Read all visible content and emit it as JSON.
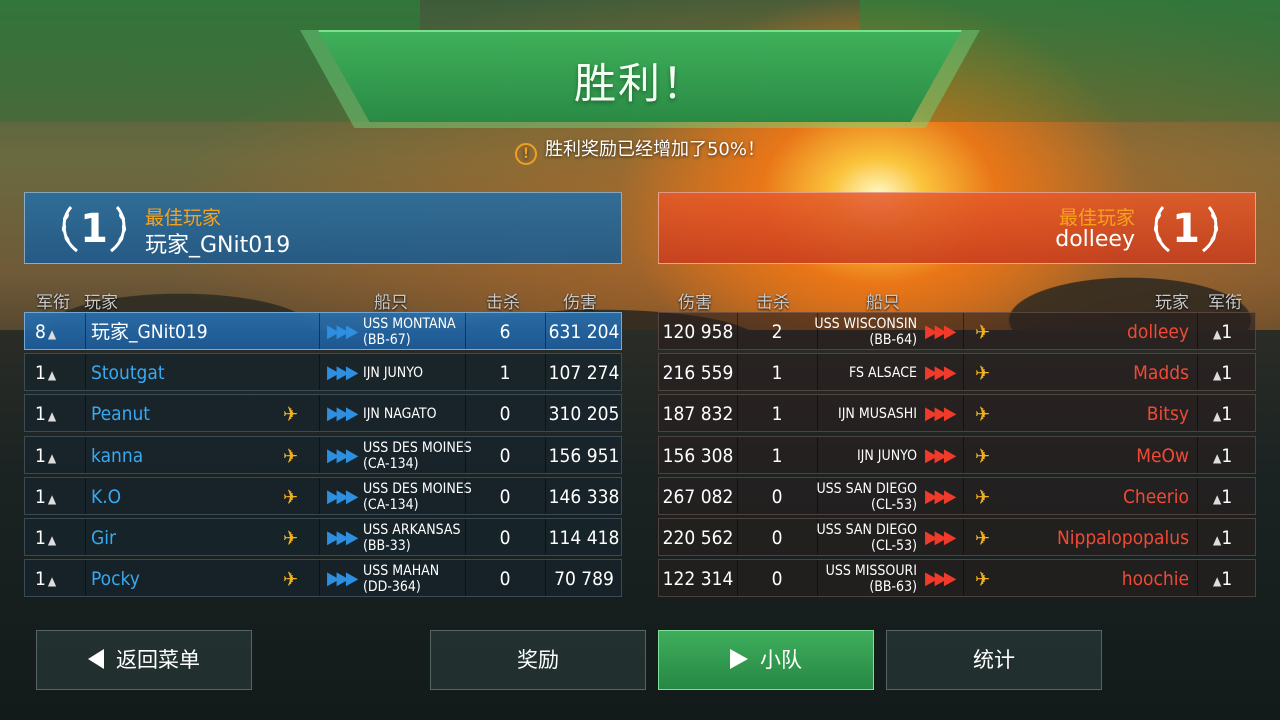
{
  "title": "胜利！",
  "bonus_text": "胜利奖励已经增加了50%！",
  "blue_mvp": {
    "label": "最佳玩家",
    "name": "玩家_GNit019",
    "rank": "1"
  },
  "red_mvp": {
    "label": "最佳玩家",
    "name": "dolleey",
    "rank": "1"
  },
  "headers": {
    "left": {
      "rank": "军衔",
      "player": "玩家",
      "ship": "船只",
      "kills": "击杀",
      "damage": "伤害"
    },
    "right": {
      "damage": "伤害",
      "kills": "击杀",
      "ship": "船只",
      "player": "玩家",
      "rank": "军衔"
    }
  },
  "blue_team": [
    {
      "rank": "8",
      "player": "玩家_GNit019",
      "ship1": "USS MONTANA",
      "ship2": "(BB-67)",
      "kills": "6",
      "damage": "631 204",
      "plane": false
    },
    {
      "rank": "1",
      "player": "Stoutgat",
      "ship1": "IJN JUNYO",
      "ship2": "",
      "kills": "1",
      "damage": "107 274",
      "plane": false
    },
    {
      "rank": "1",
      "player": "Peanut",
      "ship1": "IJN NAGATO",
      "ship2": "",
      "kills": "0",
      "damage": "310 205",
      "plane": true
    },
    {
      "rank": "1",
      "player": "kanna",
      "ship1": "USS DES MOINES",
      "ship2": "(CA-134)",
      "kills": "0",
      "damage": "156 951",
      "plane": true
    },
    {
      "rank": "1",
      "player": "K.O",
      "ship1": "USS DES MOINES",
      "ship2": "(CA-134)",
      "kills": "0",
      "damage": "146 338",
      "plane": true
    },
    {
      "rank": "1",
      "player": "Gir",
      "ship1": "USS ARKANSAS",
      "ship2": "(BB-33)",
      "kills": "0",
      "damage": "114 418",
      "plane": true
    },
    {
      "rank": "1",
      "player": "Pocky",
      "ship1": "USS MAHAN",
      "ship2": "(DD-364)",
      "kills": "0",
      "damage": "70 789",
      "plane": true
    }
  ],
  "red_team": [
    {
      "damage": "120 958",
      "kills": "2",
      "ship1": "USS WISCONSIN",
      "ship2": "(BB-64)",
      "player": "dolleey",
      "rank": "1"
    },
    {
      "damage": "216 559",
      "kills": "1",
      "ship1": "FS ALSACE",
      "ship2": "",
      "player": "Madds",
      "rank": "1"
    },
    {
      "damage": "187 832",
      "kills": "1",
      "ship1": "IJN MUSASHI",
      "ship2": "",
      "player": "Bitsy",
      "rank": "1"
    },
    {
      "damage": "156 308",
      "kills": "1",
      "ship1": "IJN JUNYO",
      "ship2": "",
      "player": "MeOw",
      "rank": "1"
    },
    {
      "damage": "267 082",
      "kills": "0",
      "ship1": "USS SAN DIEGO",
      "ship2": "(CL-53)",
      "player": "Cheerio",
      "rank": "1"
    },
    {
      "damage": "220 562",
      "kills": "0",
      "ship1": "USS SAN DIEGO",
      "ship2": "(CL-53)",
      "player": "Nippalopopalus",
      "rank": "1"
    },
    {
      "damage": "122 314",
      "kills": "0",
      "ship1": "USS MISSOURI",
      "ship2": "(BB-63)",
      "player": "hoochie",
      "rank": "1"
    }
  ],
  "buttons": {
    "back": "返回菜单",
    "rewards": "奖励",
    "squad": "小队",
    "stats": "统计"
  },
  "colors": {
    "blue_accent": "#38a8f0",
    "red_accent": "#f04a36",
    "mvp_label": "#f7a21b",
    "victory_green": "#3fb05a"
  }
}
